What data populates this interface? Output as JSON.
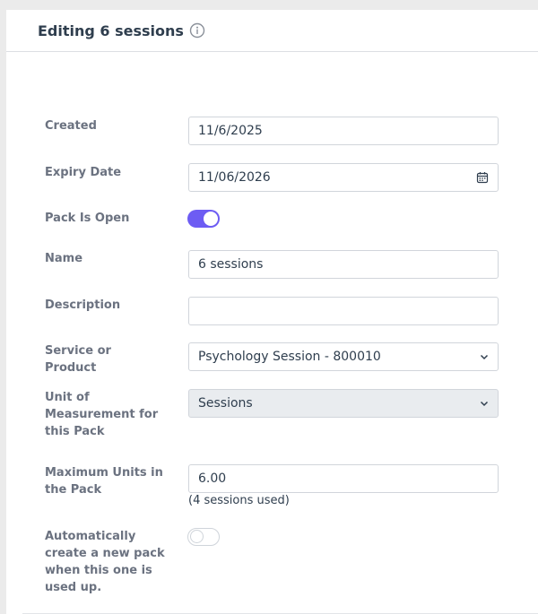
{
  "header": {
    "title": "Editing 6 sessions"
  },
  "form": {
    "created": {
      "label": "Created",
      "value": "11/6/2025"
    },
    "expiry": {
      "label": "Expiry Date",
      "value": "11/06/2026"
    },
    "pack_open": {
      "label": "Pack Is Open",
      "checked": true
    },
    "name": {
      "label": "Name",
      "value": "6 sessions"
    },
    "description": {
      "label": "Description",
      "value": ""
    },
    "service": {
      "label": "Service or Product",
      "value": "Psychology Session - 800010"
    },
    "unit": {
      "label": "Unit of Measurement for this Pack",
      "value": "Sessions"
    },
    "max_units": {
      "label": "Maximum Units in the Pack",
      "value": "6.00",
      "hint": "(4 sessions used)"
    },
    "auto_create": {
      "label": "Automatically create a new pack when this one is used up.",
      "checked": false
    }
  },
  "colors": {
    "accent": "#6d5cf3",
    "label": "#6b7280",
    "text": "#2f3e4e"
  }
}
